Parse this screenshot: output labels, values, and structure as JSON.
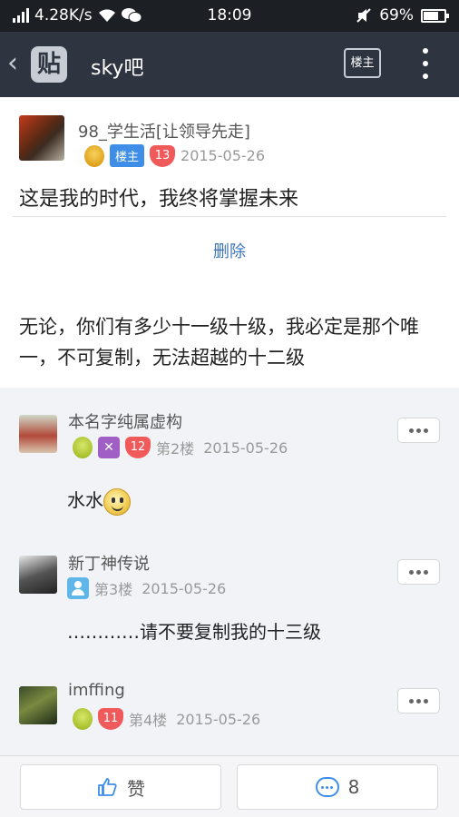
{
  "status_bar": {
    "speed": "4.28K/s",
    "time": "18:09",
    "battery": "69%",
    "battery_level": 0.69
  },
  "navbar": {
    "back_icon": "chevron-left",
    "logo": "贴",
    "title": "sky吧",
    "louzhu_button": "楼主",
    "more_icon": "more-vertical"
  },
  "main_post": {
    "username": "98_学生活[让领导先走]",
    "louzhu_tag": "楼主",
    "level": "13",
    "date": "2015-05-26",
    "title": "这是我的时代，我终将掌握未来",
    "delete_label": "删除",
    "body": "无论，你们有多少十一级十级，我必定是那个唯一，不可复制，无法超越的十二级"
  },
  "replies": [
    {
      "username": "本名字纯属虚构",
      "level": "12",
      "floor": "第2楼",
      "date": "2015-05-26",
      "text": "水水"
    },
    {
      "username": "新丁神传说",
      "floor": "第3楼",
      "date": "2015-05-26",
      "text": "…………请不要复制我的十三级"
    },
    {
      "username": "imffing",
      "level": "11",
      "floor": "第4楼",
      "date": "2015-05-26"
    }
  ],
  "bottom_bar": {
    "like_label": "赞",
    "comment_count": "8"
  },
  "colors": {
    "navbar_bg": "#2f3540",
    "status_bg": "#1c1f24",
    "accent_blue": "#3e8ee8",
    "link_blue": "#3e75b6",
    "level_red": "#f05a5a"
  }
}
